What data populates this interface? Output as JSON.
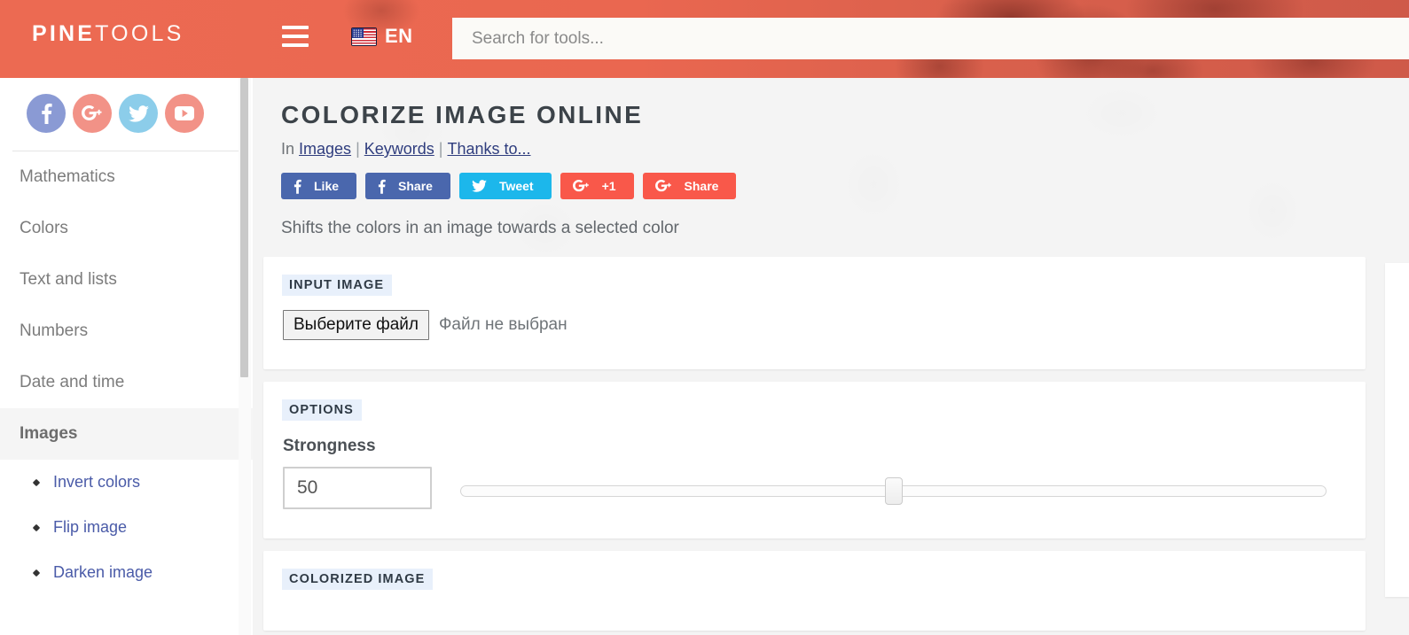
{
  "header": {
    "brand_bold": "PINE",
    "brand_light": "TOOLS",
    "menu_icon": "hamburger-icon",
    "flag_icon": "us-flag-icon",
    "lang_code": "EN",
    "search_placeholder": "Search for tools...",
    "search_value": ""
  },
  "sidebar": {
    "social": [
      {
        "name": "facebook",
        "label": "Facebook",
        "color": "#8a9ad4"
      },
      {
        "name": "googleplus",
        "label": "Google Plus",
        "color": "#f29287"
      },
      {
        "name": "twitter",
        "label": "Twitter",
        "color": "#8ccdea"
      },
      {
        "name": "youtube",
        "label": "YouTube",
        "color": "#f29287"
      }
    ],
    "categories": [
      {
        "label": "Mathematics",
        "active": false
      },
      {
        "label": "Colors",
        "active": false
      },
      {
        "label": "Text and lists",
        "active": false
      },
      {
        "label": "Numbers",
        "active": false
      },
      {
        "label": "Date and time",
        "active": false
      },
      {
        "label": "Images",
        "active": true
      }
    ],
    "subitems": [
      {
        "label": "Invert colors"
      },
      {
        "label": "Flip image"
      },
      {
        "label": "Darken image"
      }
    ]
  },
  "main": {
    "title": "COLORIZE IMAGE ONLINE",
    "breadcrumb": {
      "prefix": "In",
      "link1": "Images",
      "link2": "Keywords",
      "link3": "Thanks to...",
      "separator": "|"
    },
    "share_buttons": [
      {
        "icon": "facebook-f-icon",
        "label": "Like",
        "color": "#4a67ad"
      },
      {
        "icon": "facebook-f-icon",
        "label": "Share",
        "color": "#4a67ad"
      },
      {
        "icon": "twitter-bird-icon",
        "label": "Tweet",
        "color": "#1cb7eb"
      },
      {
        "icon": "google-plus-icon",
        "label": "+1",
        "color": "#f9584a"
      },
      {
        "icon": "google-plus-icon",
        "label": "Share",
        "color": "#f9584a"
      }
    ],
    "description": "Shifts the colors in an image towards a selected color",
    "input_section": {
      "label": "INPUT IMAGE",
      "file_button": "Выберите файл",
      "file_status": "Файл не выбран"
    },
    "options_section": {
      "label": "OPTIONS",
      "strongness_label": "Strongness",
      "strongness_value": "50",
      "slider_percent": 50
    },
    "output_section": {
      "label": "COLORIZED IMAGE"
    }
  },
  "colors": {
    "header_bg": "#e8614a",
    "accent": "#f9584a",
    "link": "#2f3d7e",
    "section_label_bg": "#e8f0fb",
    "page_bg": "#f4f4f4"
  }
}
